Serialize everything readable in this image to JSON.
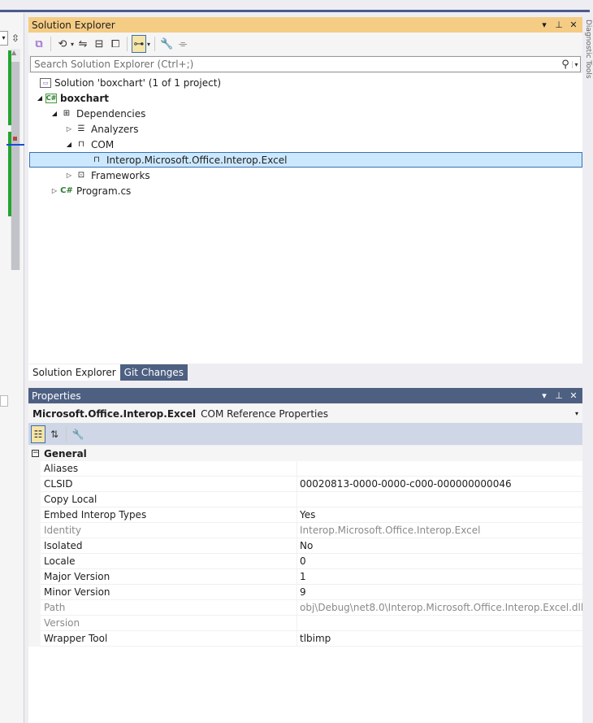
{
  "solution_explorer": {
    "title": "Solution Explorer",
    "search_placeholder": "Search Solution Explorer (Ctrl+;)",
    "tree": {
      "solution": "Solution 'boxchart' (1 of 1 project)",
      "project": "boxchart",
      "dependencies": "Dependencies",
      "analyzers": "Analyzers",
      "com": "COM",
      "com_item": "Interop.Microsoft.Office.Interop.Excel",
      "frameworks": "Frameworks",
      "program": "Program.cs"
    },
    "tabs": [
      "Solution Explorer",
      "Git Changes"
    ]
  },
  "properties": {
    "title": "Properties",
    "object_name": "Microsoft.Office.Interop.Excel",
    "object_type": "COM Reference Properties",
    "category": "General",
    "rows": [
      {
        "name": "Aliases",
        "value": ""
      },
      {
        "name": "CLSID",
        "value": "00020813-0000-0000-c000-000000000046"
      },
      {
        "name": "Copy Local",
        "value": ""
      },
      {
        "name": "Embed Interop Types",
        "value": "Yes"
      },
      {
        "name": "Identity",
        "value": "Interop.Microsoft.Office.Interop.Excel"
      },
      {
        "name": "Isolated",
        "value": "No"
      },
      {
        "name": "Locale",
        "value": "0"
      },
      {
        "name": "Major Version",
        "value": "1"
      },
      {
        "name": "Minor Version",
        "value": "9"
      },
      {
        "name": "Path",
        "value": "obj\\Debug\\net8.0\\Interop.Microsoft.Office.Interop.Excel.dll"
      },
      {
        "name": "Version",
        "value": ""
      },
      {
        "name": "Wrapper Tool",
        "value": "tlbimp"
      }
    ]
  },
  "side_strip": {
    "vertical_tab": "Diagnostic Tools"
  }
}
